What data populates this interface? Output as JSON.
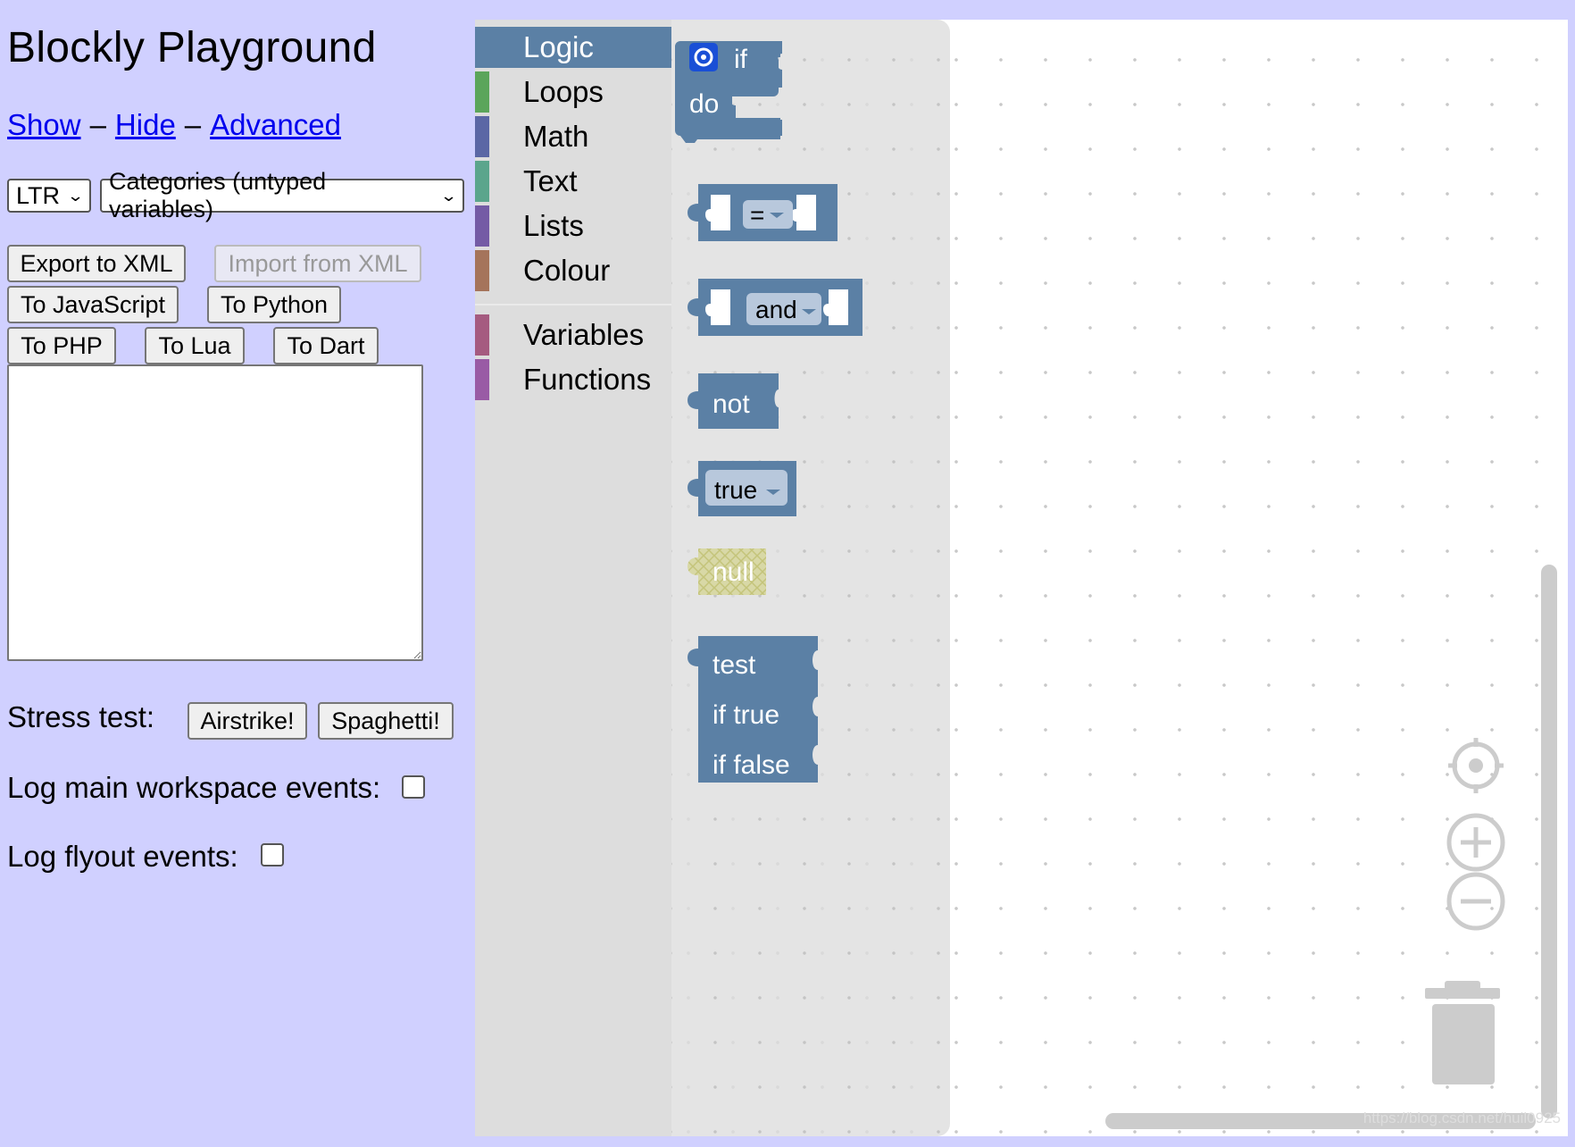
{
  "page": {
    "title": "Blockly Playground",
    "links": [
      "Show",
      "Hide",
      "Advanced"
    ],
    "separator": "–"
  },
  "controls": {
    "direction_select": "LTR",
    "toolbox_select": "Categories (untyped variables)",
    "buttons": {
      "export_xml": "Export to XML",
      "import_xml": "Import from XML",
      "to_javascript": "To JavaScript",
      "to_python": "To Python",
      "to_php": "To PHP",
      "to_lua": "To Lua",
      "to_dart": "To Dart"
    },
    "code_output": ""
  },
  "stress": {
    "label": "Stress test:",
    "airstrike": "Airstrike!",
    "spaghetti": "Spaghetti!"
  },
  "logging": {
    "main_label": "Log main workspace events:",
    "main_checked": false,
    "flyout_label": "Log flyout events:",
    "flyout_checked": false
  },
  "toolbox": {
    "categories": [
      {
        "label": "Logic",
        "color": "#5b80a5",
        "selected": true
      },
      {
        "label": "Loops",
        "color": "#5ba55b"
      },
      {
        "label": "Math",
        "color": "#5b67a5"
      },
      {
        "label": "Text",
        "color": "#5ba58c"
      },
      {
        "label": "Lists",
        "color": "#745ba5"
      },
      {
        "label": "Colour",
        "color": "#a5745b"
      },
      {
        "label": "Variables",
        "color": "#a55b80"
      },
      {
        "label": "Functions",
        "color": "#995ba5"
      }
    ]
  },
  "flyout": {
    "block_color": "#5b80a5",
    "if_block": {
      "if_label": "if",
      "do_label": "do",
      "icon": "gear-icon"
    },
    "compare_block": {
      "operator": "="
    },
    "logic_op_block": {
      "operator": "and"
    },
    "negate_block": {
      "label": "not"
    },
    "boolean_block": {
      "value": "true"
    },
    "null_block": {
      "label": "null"
    },
    "ternary_block": {
      "test": "test",
      "if_true": "if true",
      "if_false": "if false"
    }
  },
  "workspace": {
    "controls": [
      "reset-center-icon",
      "zoom-in-icon",
      "zoom-out-icon",
      "trash-icon"
    ]
  },
  "watermark": "https://blog.csdn.net/huil0925"
}
